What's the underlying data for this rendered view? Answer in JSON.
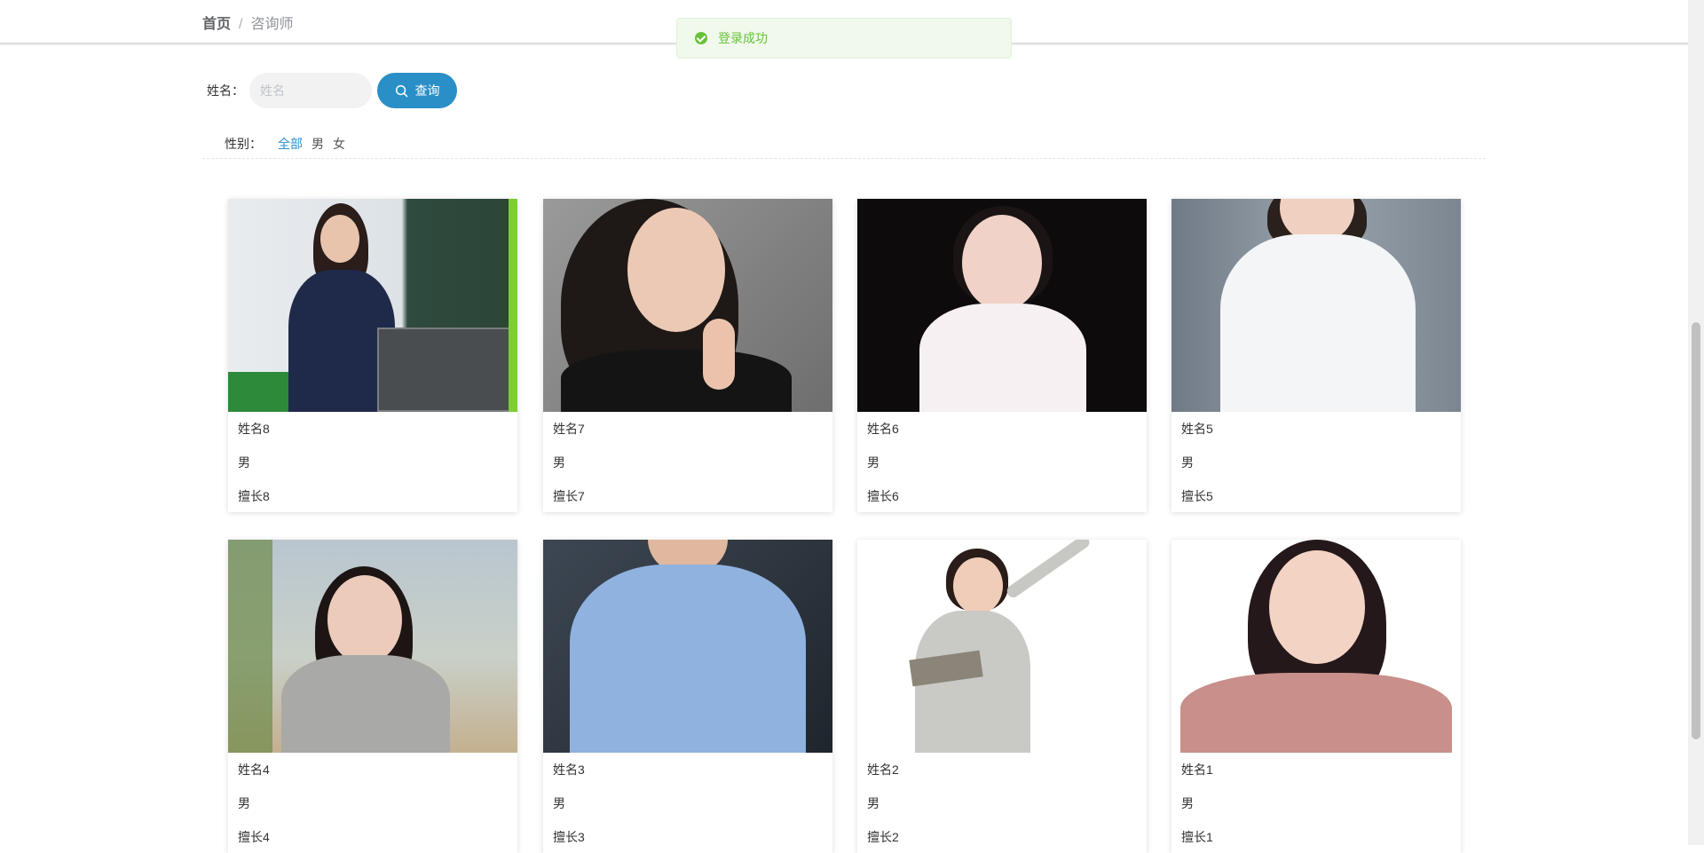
{
  "breadcrumb": {
    "home": "首页",
    "separator": "/",
    "current": "咨询师"
  },
  "toast": {
    "message": "登录成功",
    "type": "success",
    "color": "#67c23a"
  },
  "search": {
    "label": "姓名：",
    "placeholder": "姓名",
    "value": "",
    "button_label": "查询",
    "button_icon": "search-icon",
    "accent": "#2b8fc7"
  },
  "filter": {
    "label": "性别：",
    "options": [
      "全部",
      "男",
      "女"
    ],
    "active": "全部"
  },
  "counselors": [
    {
      "name": "姓名8",
      "gender": "男",
      "specialty": "擅长8"
    },
    {
      "name": "姓名7",
      "gender": "男",
      "specialty": "擅长7"
    },
    {
      "name": "姓名6",
      "gender": "男",
      "specialty": "擅长6"
    },
    {
      "name": "姓名5",
      "gender": "男",
      "specialty": "擅长5"
    },
    {
      "name": "姓名4",
      "gender": "男",
      "specialty": "擅长4"
    },
    {
      "name": "姓名3",
      "gender": "男",
      "specialty": "擅长3"
    },
    {
      "name": "姓名2",
      "gender": "男",
      "specialty": "擅长2"
    },
    {
      "name": "姓名1",
      "gender": "男",
      "specialty": "擅长1"
    }
  ]
}
